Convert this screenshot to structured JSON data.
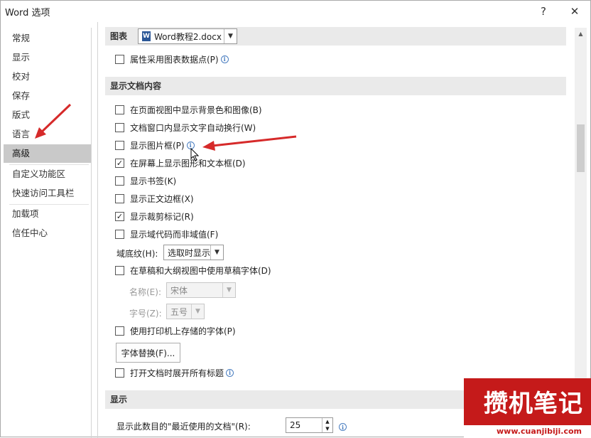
{
  "window": {
    "title": "Word 选项",
    "help_label": "?",
    "close_label": "✕"
  },
  "sidebar": {
    "items": [
      {
        "label": "常规"
      },
      {
        "label": "显示"
      },
      {
        "label": "校对"
      },
      {
        "label": "保存"
      },
      {
        "label": "版式"
      },
      {
        "label": "语言"
      },
      {
        "label": "高级",
        "selected": true
      },
      {
        "label": "自定义功能区"
      },
      {
        "label": "快速访问工具栏"
      },
      {
        "label": "加载项"
      },
      {
        "label": "信任中心"
      }
    ]
  },
  "chart_section": {
    "label": "图表",
    "file_value": "Word教程2.docx",
    "checkbox_label": "属性采用图表数据点(P)",
    "checkbox_checked": false
  },
  "doc_content": {
    "header": "显示文档内容",
    "options": [
      {
        "label": "在页面视图中显示背景色和图像(B)",
        "checked": false
      },
      {
        "label": "文档窗口内显示文字自动换行(W)",
        "checked": false
      },
      {
        "label": "显示图片框(P)",
        "checked": false,
        "info": true
      },
      {
        "label": "在屏幕上显示图形和文本框(D)",
        "checked": true
      },
      {
        "label": "显示书签(K)",
        "checked": false
      },
      {
        "label": "显示正文边框(X)",
        "checked": false
      },
      {
        "label": "显示裁剪标记(R)",
        "checked": true
      },
      {
        "label": "显示域代码而非域值(F)",
        "checked": false
      }
    ],
    "field_shading_label": "域底纹(H):",
    "field_shading_value": "选取时显示",
    "draft_font_label": "在草稿和大纲视图中使用草稿字体(D)",
    "draft_font_checked": false,
    "font_name_label": "名称(E):",
    "font_name_value": "宋体",
    "font_size_label": "字号(Z):",
    "font_size_value": "五号",
    "printer_fonts_label": "使用打印机上存储的字体(P)",
    "printer_fonts_checked": false,
    "font_sub_button": "字体替换(F)...",
    "expand_headings_label": "打开文档时展开所有标题",
    "expand_headings_checked": false
  },
  "display": {
    "header": "显示",
    "recent_docs_label": "显示此数目的\"最近使用的文档\"(R):",
    "recent_docs_value": "25"
  },
  "watermark": {
    "text": "攒机笔记",
    "url": "www.cuanjibiji.com"
  },
  "check_mark": "✓",
  "info_mark": "i",
  "dropdown_mark": "▼",
  "up_mark": "▲",
  "colors": {
    "accent_red": "#d62a2a",
    "selection": "#c9c9c9"
  }
}
